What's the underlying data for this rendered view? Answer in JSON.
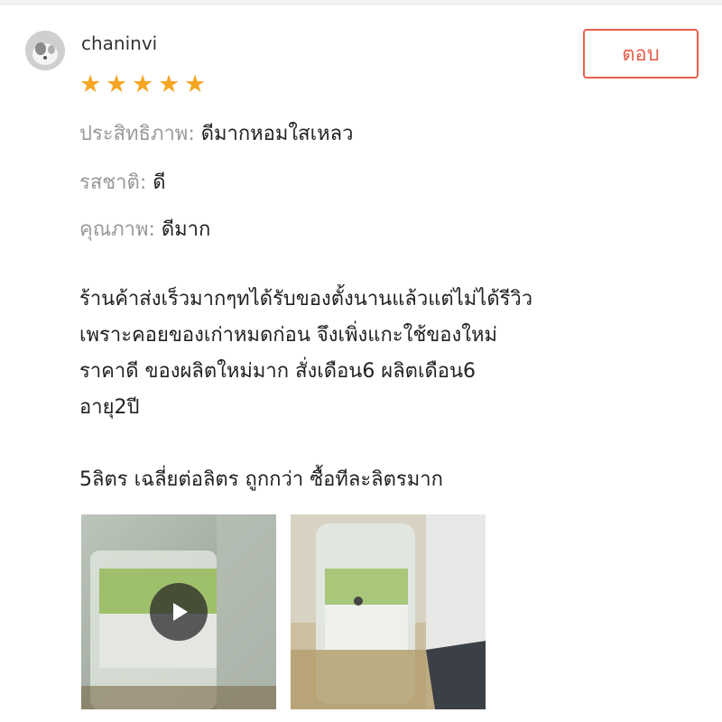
{
  "review": {
    "username": "chaninvi",
    "rating": 5,
    "reply_label": "ตอบ",
    "attributes": [
      {
        "label": "ประสิทธิภาพ: ",
        "value": "ดีมากหอมใสเหลว"
      },
      {
        "label": "รสชาติ: ",
        "value": "ดี"
      },
      {
        "label": "คุณภาพ: ",
        "value": "ดีมาก"
      }
    ],
    "body_lines": [
      "ร้านค้าส่งเร็วมากๆทได้รับของตั้งนานแล้วแต่ไม่ได้รีวิว",
      "เพราะคอยของเก่าหมดก่อน จึงเพิ่งแกะใช้ของใหม่",
      "ราคาดี ของผลิตใหม่มาก สั่งเดือน6 ผลิตเดือน6",
      "อายุ2ปี",
      "",
      "5ลิตร เฉลี่ยต่อลิตร ถูกกว่า ซื้อทีละลิตรมาก"
    ],
    "media": [
      {
        "type": "video",
        "icon": "play-icon"
      },
      {
        "type": "photo"
      }
    ]
  },
  "colors": {
    "accent": "#e8604c",
    "star": "#f5a623",
    "muted_text": "#999999",
    "text": "#222222"
  }
}
